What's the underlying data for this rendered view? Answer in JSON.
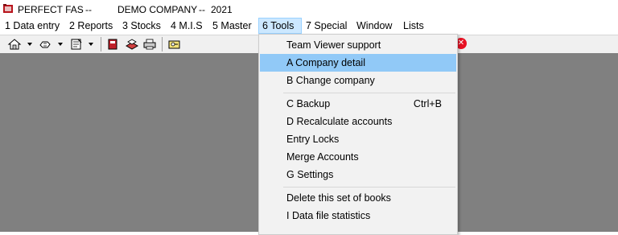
{
  "window": {
    "app_name": "PERFECT FAS",
    "sep1": "--",
    "company": "DEMO COMPANY",
    "sep2": "--",
    "year": "2021"
  },
  "menubar": {
    "items": [
      {
        "label": "1  Data entry"
      },
      {
        "label": "2  Reports"
      },
      {
        "label": "3  Stocks"
      },
      {
        "label": "4  M.I.S"
      },
      {
        "label": "5  Master"
      },
      {
        "label": "6  Tools"
      },
      {
        "label": "7  Special"
      },
      {
        "label": "Window"
      },
      {
        "label": "Lists"
      }
    ]
  },
  "toolbar": {
    "icons": [
      "home-icon",
      "hand-icon",
      "notepad-icon",
      "book-red-icon",
      "book-open-icon",
      "printer-icon",
      "key-icon",
      "close-icon"
    ]
  },
  "tools_menu": {
    "items": [
      {
        "label": "Team Viewer support",
        "shortcut": ""
      },
      {
        "label": "A  Company detail",
        "shortcut": ""
      },
      {
        "label": "B  Change company",
        "shortcut": ""
      },
      {
        "label": "C  Backup",
        "shortcut": "Ctrl+B"
      },
      {
        "label": "D  Recalculate accounts",
        "shortcut": ""
      },
      {
        "label": "Entry Locks",
        "shortcut": ""
      },
      {
        "label": "Merge Accounts",
        "shortcut": ""
      },
      {
        "label": "G  Settings",
        "shortcut": ""
      },
      {
        "label": "Delete this set of books",
        "shortcut": ""
      },
      {
        "label": "I  Data file statistics",
        "shortcut": ""
      }
    ],
    "highlighted_color": "#91c9f7"
  },
  "colors": {
    "workspace": "#808080",
    "menu_active": "#cce8ff"
  }
}
